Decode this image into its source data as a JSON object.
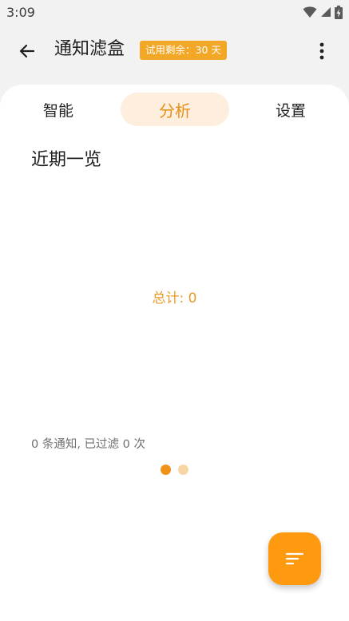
{
  "status_bar": {
    "time": "3:09",
    "icons": [
      "wifi-icon",
      "cell-signal-icon",
      "battery-charging-icon"
    ]
  },
  "app_bar": {
    "title": "通知滤盒",
    "trial_badge": "试用剩余：30 天",
    "back_icon": "arrow-left-icon",
    "menu_icon": "more-vert-icon"
  },
  "tabs": [
    {
      "label": "智能",
      "selected": false
    },
    {
      "label": "分析",
      "selected": true
    },
    {
      "label": "设置",
      "selected": false
    }
  ],
  "overview": {
    "title": "近期一览",
    "total": "总计: 0",
    "summary": "0 条通知, 已过滤 0 次"
  },
  "pager": {
    "pages": 2,
    "current": 1
  },
  "fab": {
    "icon": "sort-icon"
  },
  "colors": {
    "accent": "#f0921a",
    "badge": "#f3a727",
    "tab_selected_bg": "#fdeedd",
    "fab": "#ff9a10"
  }
}
